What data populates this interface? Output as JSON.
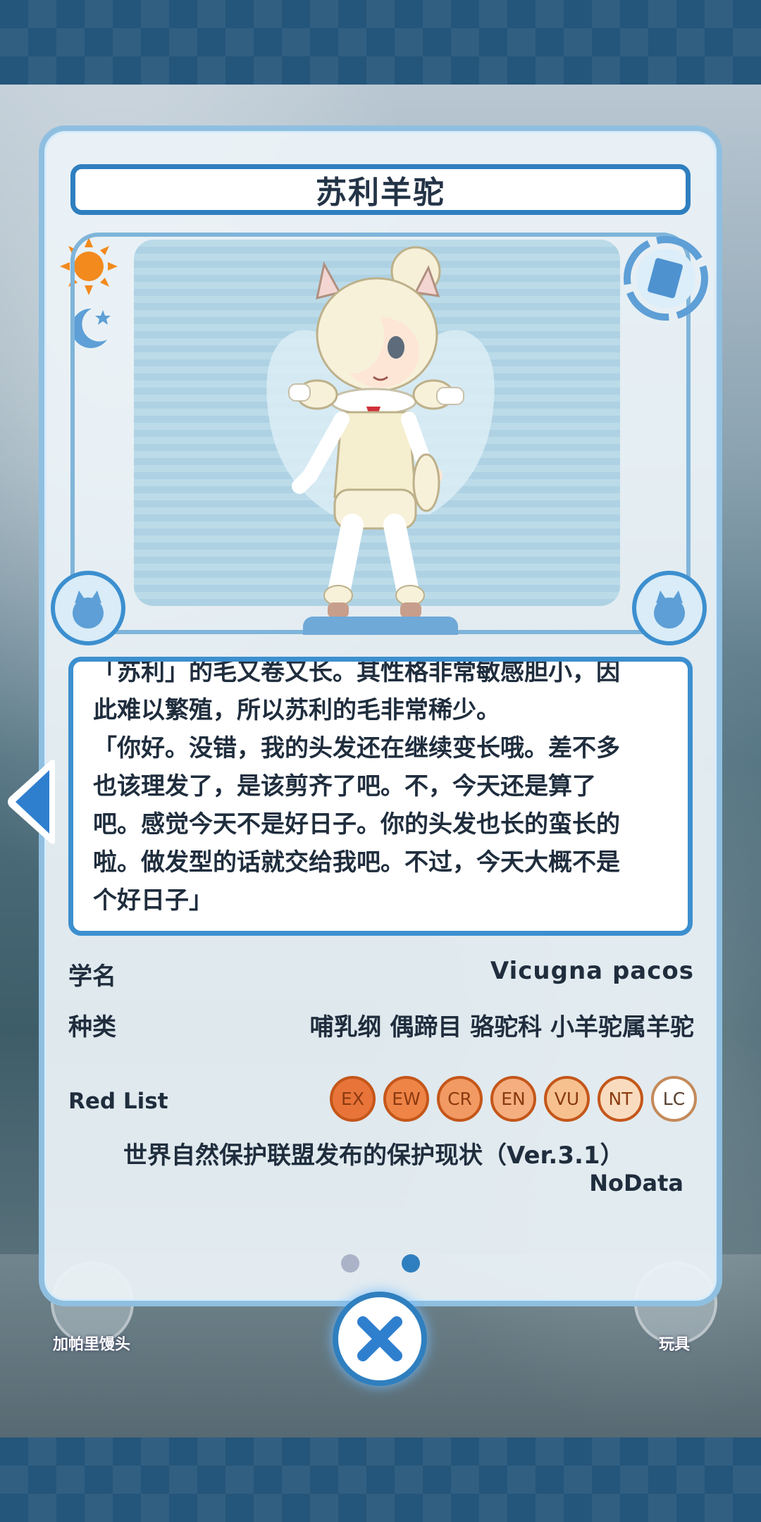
{
  "card": {
    "title": "苏利羊驼"
  },
  "icons": {
    "day": "sun-icon",
    "night": "moon-star-icon",
    "side": "book-icon",
    "prev": "left-arrow-icon",
    "close": "close-icon"
  },
  "background_labels": {
    "left": "加帕里馒头",
    "right": "玩具"
  },
  "description": {
    "lines": [
      "「苏利」的毛又卷又长。其性格非常敏感胆小，因",
      "此难以繁殖，所以苏利的毛非常稀少。",
      "「你好。没错，我的头发还在继续变长哦。差不多",
      "也该理发了，是该剪齐了吧。不，今天还是算了",
      "吧。感觉今天不是好日子。你的头发也长的蛮长的",
      "啦。做发型的话就交给我吧。不过，今天大概不是",
      "个好日子」"
    ]
  },
  "info": {
    "scientific_label": "学名",
    "scientific_value": "Vicugna pacos",
    "class_label": "种类",
    "class_value": "哺乳纲 偶蹄目 骆驼科 小羊驼属羊驼",
    "redlist_label": "Red List",
    "redlist_items": [
      "EX",
      "EW",
      "CR",
      "EN",
      "VU",
      "NT",
      "LC"
    ],
    "redlist_colors": [
      "#e9743a",
      "#ef8447",
      "#f29a63",
      "#f4ae80",
      "#f6c18f",
      "#f9dcbf",
      "#ffffff"
    ],
    "iucn_note": "世界自然保护联盟发布的保护现状（Ver.3.1）",
    "status": "NoData"
  },
  "pager": {
    "total": 2,
    "active_index": 1
  }
}
